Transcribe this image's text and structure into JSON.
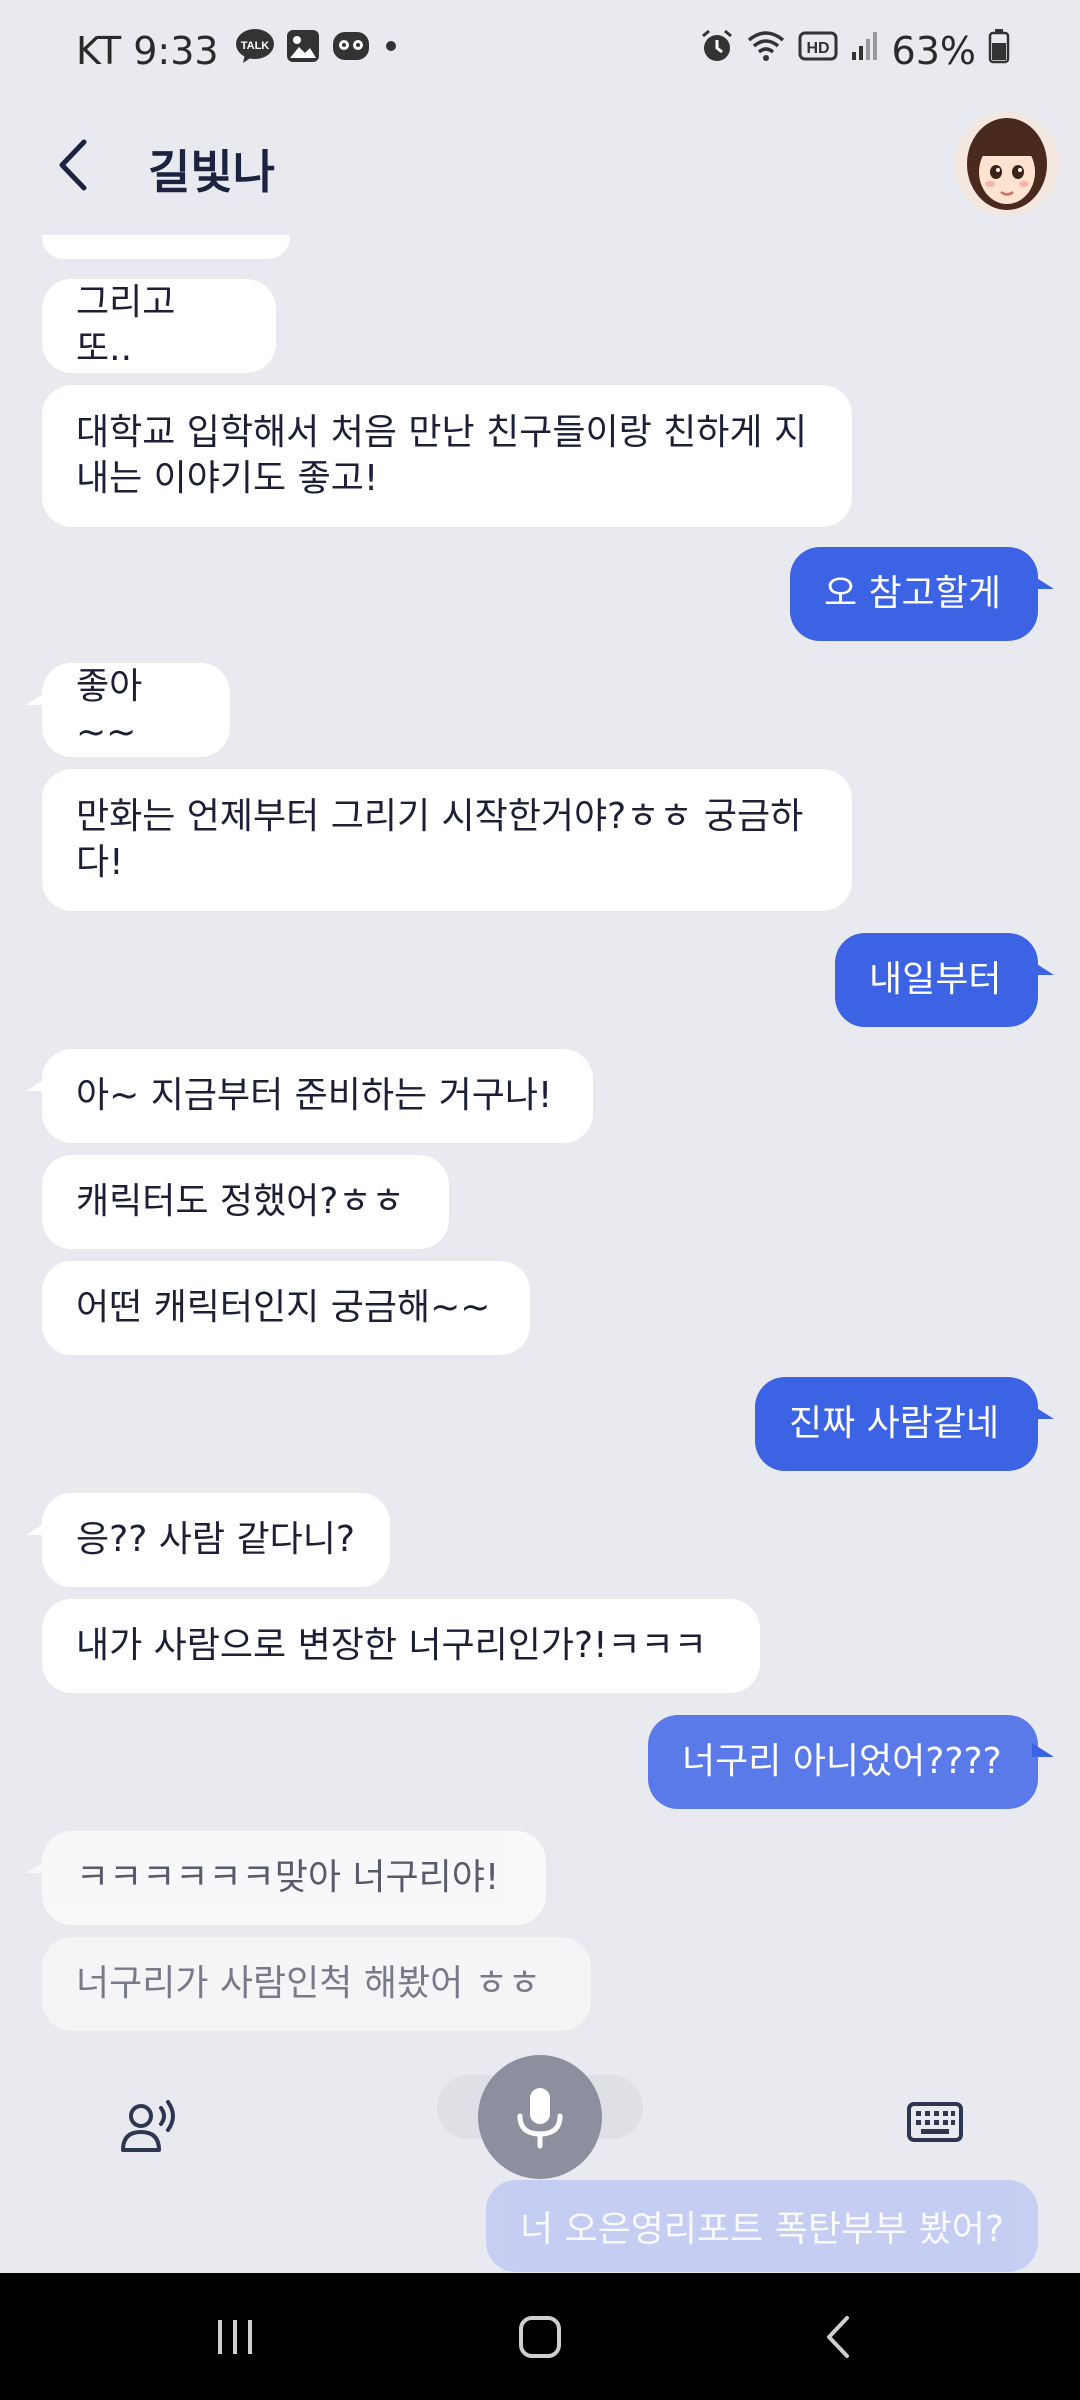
{
  "status_bar": {
    "carrier_time": "KT 9:33",
    "talk_badge": "TALK",
    "hd_badge": "HD",
    "battery": "63%"
  },
  "header": {
    "title": "길빛나"
  },
  "messages": [
    {
      "from": "bot",
      "text": "그리고 또.."
    },
    {
      "from": "bot",
      "text": "대학교 입학해서 처음 만난 친구들이랑 친하게 지내는 이야기도 좋고!"
    },
    {
      "from": "user",
      "text": "오 참고할게"
    },
    {
      "from": "bot",
      "text": "좋아~~"
    },
    {
      "from": "bot",
      "text": "만화는 언제부터 그리기 시작한거야?ㅎㅎ 궁금하다!"
    },
    {
      "from": "user",
      "text": "내일부터"
    },
    {
      "from": "bot",
      "text": "아~ 지금부터 준비하는 거구나!"
    },
    {
      "from": "bot",
      "text": "캐릭터도 정했어?ㅎㅎ"
    },
    {
      "from": "bot",
      "text": "어떤 캐릭터인지 궁금해~~"
    },
    {
      "from": "user",
      "text": "진짜 사람같네"
    },
    {
      "from": "bot",
      "text": "응?? 사람 같다니?"
    },
    {
      "from": "bot",
      "text": "내가 사람으로 변장한 너구리인가?!ㅋㅋㅋ"
    },
    {
      "from": "user",
      "text": "너구리 아니었어????"
    },
    {
      "from": "bot",
      "text": "ㅋㅋㅋㅋㅋㅋ맞아 너구리야!"
    },
    {
      "from": "bot",
      "text": "너구리가 사람인척 해봤어 ㅎㅎ"
    }
  ],
  "pending_message": "너 오은영리포트 폭탄부부 봤어?",
  "colors": {
    "background": "#e9eaef",
    "user_bubble": "#3d63e5",
    "bot_bubble": "#ffffff",
    "title": "#1c2340"
  },
  "icons": {
    "back": "back-arrow-icon",
    "voice": "voice-mode-icon",
    "mic": "microphone-icon",
    "keyboard": "keyboard-icon"
  }
}
